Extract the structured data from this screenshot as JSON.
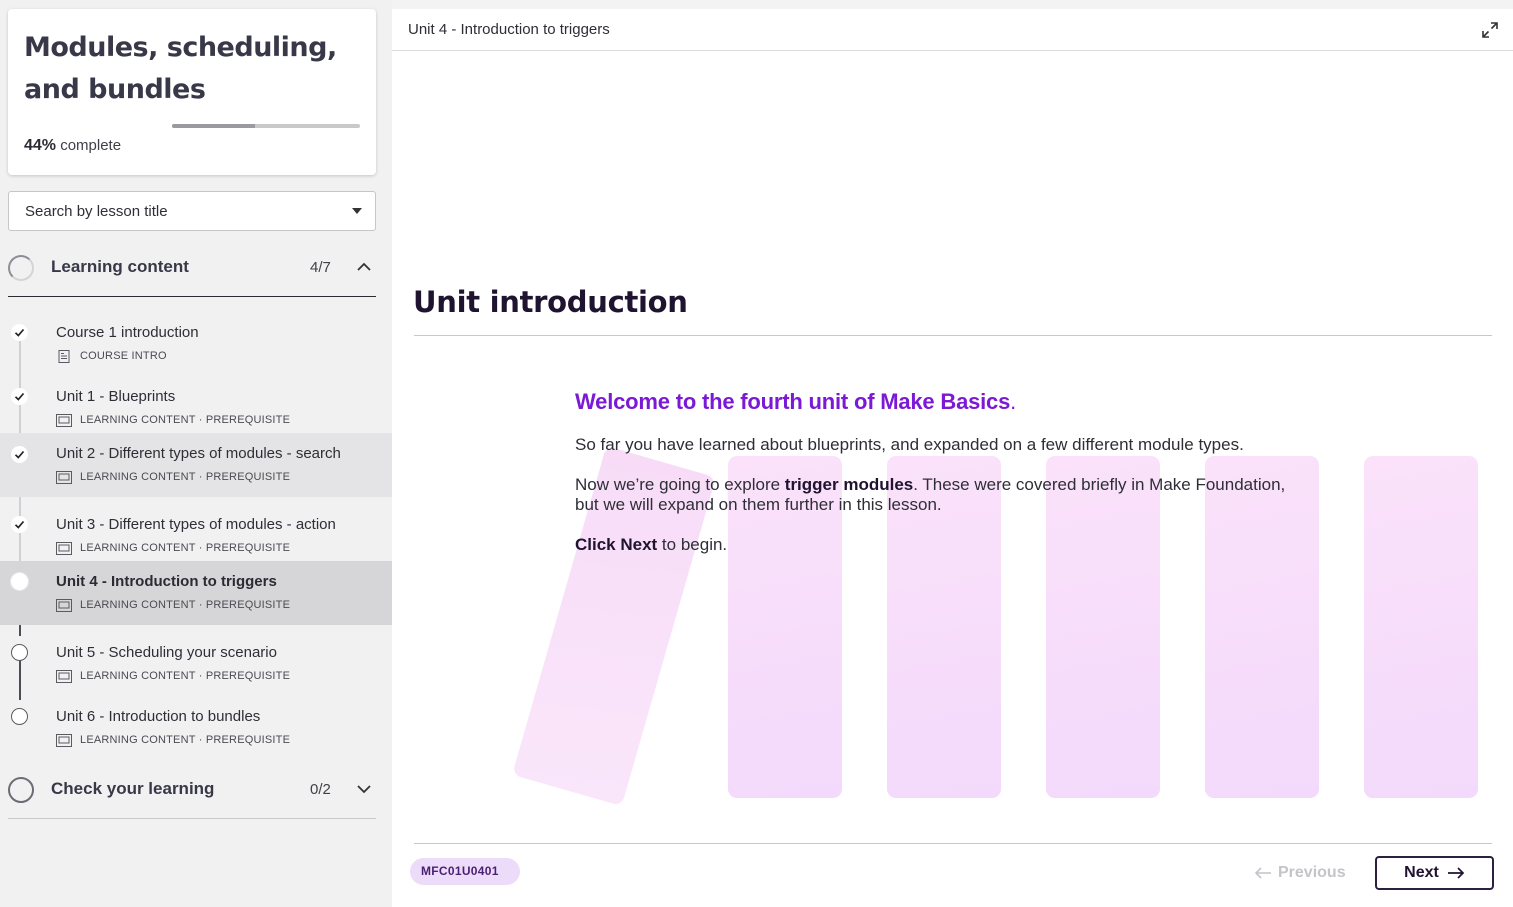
{
  "sidebar": {
    "course_title": "Modules, scheduling, and bundles",
    "progress_percent": "44%",
    "progress_label": "complete",
    "progress_value": 0.44,
    "search_placeholder": "Search by lesson title",
    "sections": [
      {
        "title": "Learning content",
        "count": "4/7",
        "expanded": true,
        "lessons": [
          {
            "title": "Course 1 introduction",
            "meta": "COURSE INTRO",
            "status": "done",
            "icon": "document-icon"
          },
          {
            "title": "Unit 1 - Blueprints",
            "meta": "LEARNING CONTENT · PREREQUISITE",
            "status": "done",
            "icon": "presentation-icon"
          },
          {
            "title": "Unit 2 - Different types of modules - search",
            "meta": "LEARNING CONTENT · PREREQUISITE",
            "status": "done",
            "icon": "presentation-icon"
          },
          {
            "title": "Unit 3 - Different types of modules - action",
            "meta": "LEARNING CONTENT · PREREQUISITE",
            "status": "done",
            "icon": "presentation-icon"
          },
          {
            "title": "Unit 4 - Introduction to triggers",
            "meta": "LEARNING CONTENT · PREREQUISITE",
            "status": "current",
            "icon": "presentation-icon"
          },
          {
            "title": "Unit 5 - Scheduling your scenario",
            "meta": "LEARNING CONTENT · PREREQUISITE",
            "status": "todo",
            "icon": "presentation-icon"
          },
          {
            "title": "Unit 6 - Introduction to bundles",
            "meta": "LEARNING CONTENT · PREREQUISITE",
            "status": "todo",
            "icon": "presentation-icon"
          }
        ]
      },
      {
        "title": "Check your learning",
        "count": "0/2",
        "expanded": false
      }
    ]
  },
  "main": {
    "breadcrumb": "Unit 4 - Introduction to triggers",
    "heading": "Unit introduction",
    "welcome": "Welcome to the fourth unit of Make Basics",
    "welcome_dot": ".",
    "para1": "So far you have learned about blueprints, and expanded on a few different module types.",
    "para2_pre": "Now we’re going to explore ",
    "para2_bold": "trigger modules",
    "para2_post": ". These were covered briefly in Make Foundation, but we will expand on them further in this lesson.",
    "para3_bold": "Click Next",
    "para3_post": " to begin.",
    "lesson_code": "MFC01U0401",
    "prev_label": "Previous",
    "next_label": "Next"
  },
  "colors": {
    "accent_purple": "#7b19d6",
    "heading_dark": "#1f1330",
    "badge_bg": "#ecdcf9",
    "illustration_pink": "#f8dcf9"
  }
}
